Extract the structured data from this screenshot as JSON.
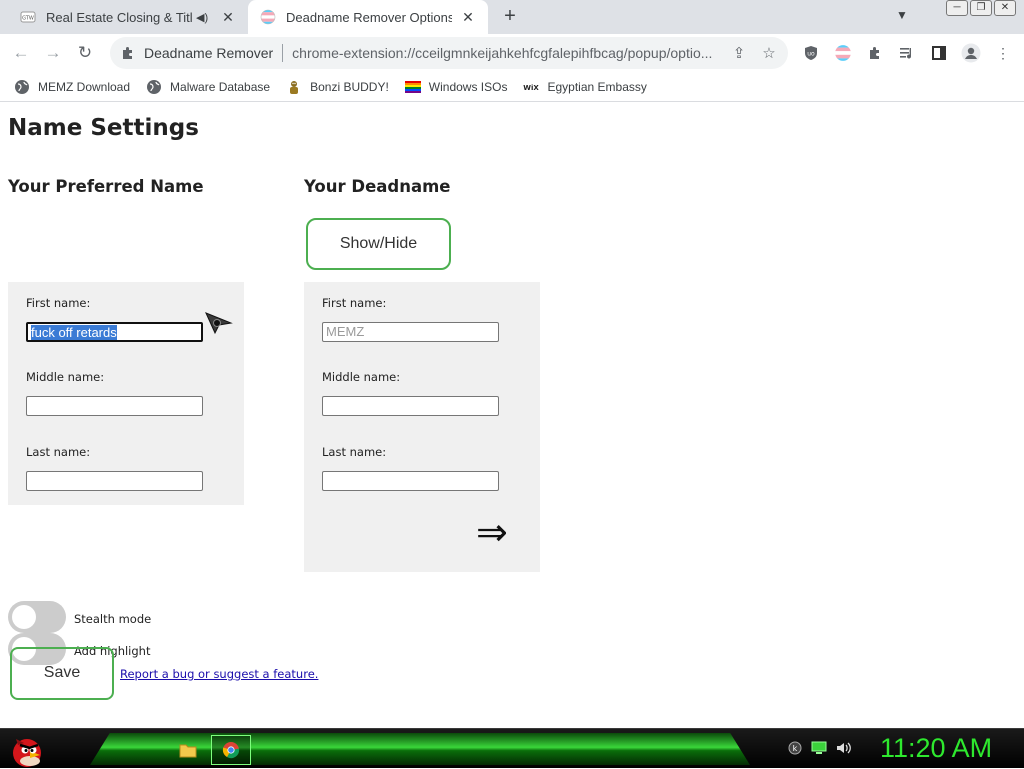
{
  "browser": {
    "tabs": [
      {
        "title": "Real Estate Closing & Title Sc",
        "active": false,
        "audio": true
      },
      {
        "title": "Deadname Remover Options",
        "active": true,
        "audio": false
      }
    ],
    "omnibox": {
      "extension_name": "Deadname Remover",
      "url": "chrome-extension://cceilgmnkeijahkehfcgfalepihfbcag/popup/optio..."
    },
    "bookmarks": [
      {
        "label": "MEMZ Download",
        "icon": "globe-icon"
      },
      {
        "label": "Malware Database",
        "icon": "globe-icon"
      },
      {
        "label": "Bonzi BUDDY!",
        "icon": "bonzi-icon"
      },
      {
        "label": "Windows ISOs",
        "icon": "rainbow-flag-icon"
      },
      {
        "label": "Egyptian Embassy",
        "icon": "wix-icon"
      }
    ]
  },
  "page": {
    "title": "Name Settings",
    "preferred": {
      "heading": "Your Preferred Name",
      "first_label": "First name:",
      "first_value": "fuck off retards",
      "middle_label": "Middle name:",
      "middle_value": "",
      "last_label": "Last name:",
      "last_value": ""
    },
    "deadname": {
      "heading": "Your Deadname",
      "toggle_button": "Show/Hide",
      "first_label": "First name:",
      "first_placeholder": "MEMZ",
      "middle_label": "Middle name:",
      "last_label": "Last name:",
      "arrow": "⇒"
    },
    "options": {
      "stealth_label": "Stealth mode",
      "stealth_on": false,
      "highlight_label": "Add highlight",
      "highlight_on": false
    },
    "save_label": "Save",
    "report_link": "Report a bug or suggest a feature."
  },
  "taskbar": {
    "clock": "11:20 AM"
  },
  "colors": {
    "accent_green": "#4caf50",
    "panel_bg": "#f0f0f0",
    "clock_green": "#2ee82e"
  }
}
